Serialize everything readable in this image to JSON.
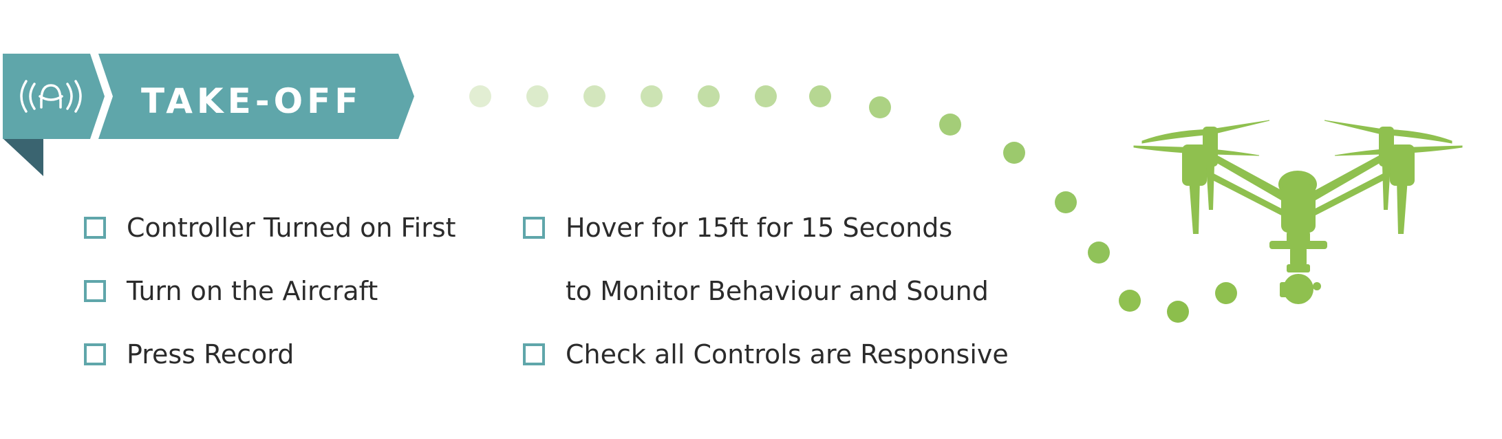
{
  "banner": {
    "title": "TAKE-OFF",
    "icon": "aircraft-signal-icon",
    "colors": {
      "main": "#5fa6aa",
      "fold": "#3a6470",
      "text": "#ffffff"
    }
  },
  "checklist": {
    "checkbox_color": "#5fa6aa",
    "left_column": [
      {
        "label": "Controller Turned on First",
        "checked": false
      },
      {
        "label": "Turn on the Aircraft",
        "checked": false
      },
      {
        "label": "Press Record",
        "checked": false
      }
    ],
    "right_column": [
      {
        "label": "Hover for 15ft for 15 Seconds",
        "continuation": "to Monitor Behaviour and Sound",
        "checked": false
      },
      {
        "label": "Check all Controls are Responsive",
        "checked": false
      }
    ]
  },
  "illustration": {
    "icon": "drone-icon",
    "flight_path": "dotted-arc",
    "colors": {
      "drone": "#8fc04f",
      "dots": [
        "#e2eed3",
        "#dcebcb",
        "#d3e6bd",
        "#cce3b3",
        "#c3dea6",
        "#bedb9e",
        "#b6d792",
        "#acd283",
        "#a4cd78",
        "#9cc96d",
        "#95c562",
        "#90c259",
        "#8fc04f",
        "#8cbe4c",
        "#8fc04f"
      ]
    }
  }
}
